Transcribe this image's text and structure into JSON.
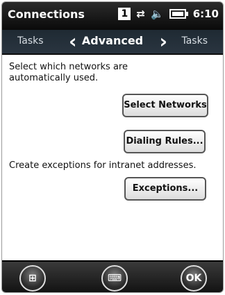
{
  "header": {
    "app_title": "Connections",
    "sim_number": "1",
    "time": "6:10",
    "icons": [
      "data-transfer-icon",
      "volume-icon",
      "battery-icon"
    ]
  },
  "tabs": {
    "left": "Tasks",
    "current": "Advanced",
    "right": "Tasks",
    "prev_icon": "chevron-left-icon",
    "next_icon": "chevron-right-icon"
  },
  "content": {
    "text_auto_networks": "Select which networks are automatically used.",
    "btn_select_networks": "Select Networks",
    "btn_dialing_rules": "Dialing Rules...",
    "text_exceptions": "Create exceptions for intranet addresses.",
    "btn_exceptions": "Exceptions..."
  },
  "bottom": {
    "start_icon": "windows-start-icon",
    "keyboard_icon": "keyboard-icon",
    "ok_label": "OK"
  }
}
